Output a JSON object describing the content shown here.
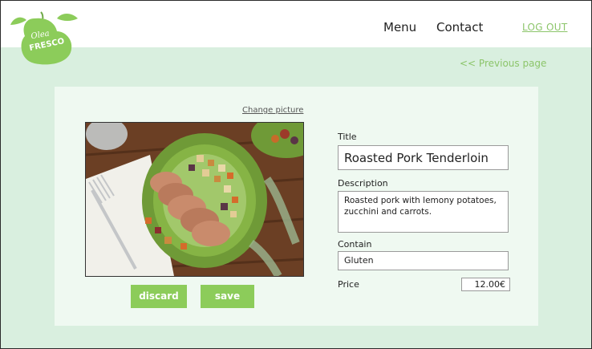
{
  "header": {
    "logo_text_top": "Olea",
    "logo_text_bottom": "FRESCO",
    "nav": [
      {
        "label": "Menu"
      },
      {
        "label": "Contact"
      }
    ],
    "logout_label": "LOG OUT"
  },
  "previous_page_label": "<< Previous page",
  "editor": {
    "change_picture_label": "Change picture",
    "discard_label": "discard",
    "save_label": "save",
    "title_label": "Title",
    "title_value": "Roasted Pork Tenderloin",
    "description_label": "Description",
    "description_value": "Roasted pork with lemony potatoes, zucchini and carrots.",
    "contain_label": "Contain",
    "contain_value": "Gluten",
    "price_label": "Price",
    "price_value": "12.00€"
  },
  "colors": {
    "accent_green": "#8ccc5a",
    "page_background": "#d9efdf",
    "card_background": "#eff9f1"
  }
}
